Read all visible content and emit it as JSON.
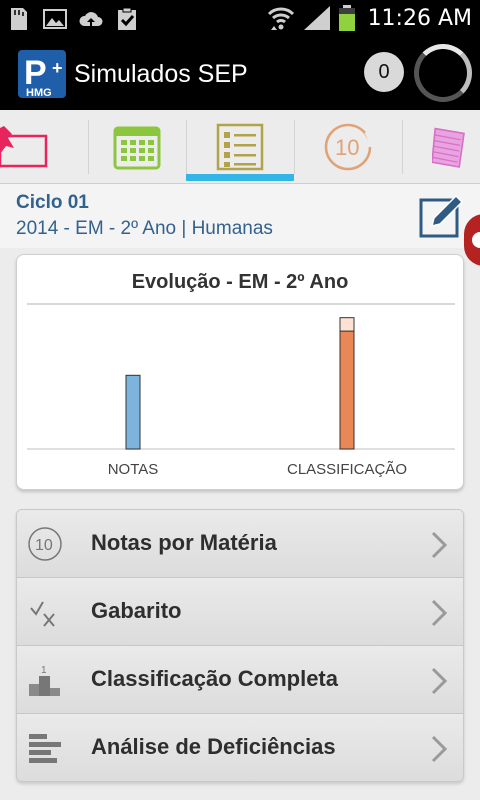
{
  "status_bar": {
    "time": "11:26 AM",
    "icons": [
      "sd-card-icon",
      "image-icon",
      "cloud-upload-icon",
      "clipboard-check-icon",
      "wifi-icon",
      "signal-icon",
      "battery-icon"
    ]
  },
  "action_bar": {
    "title": "Simulados SEP",
    "logo_text": "P",
    "logo_sub": "HMG",
    "badge_count": "0"
  },
  "tabs": [
    {
      "name": "pinned-note-tab",
      "icon": "pushpin-note-icon",
      "color": "#e8245c"
    },
    {
      "name": "calendar-tab",
      "icon": "calendar-icon",
      "color": "#8cc63f"
    },
    {
      "name": "checklist-tab",
      "icon": "checklist-icon",
      "color": "#b2a24a",
      "selected": true
    },
    {
      "name": "score-tab",
      "icon": "score-10-icon",
      "color": "#e0a276"
    },
    {
      "name": "notebook-tab",
      "icon": "notebook-icon",
      "color": "#d670c6"
    }
  ],
  "cycle": {
    "title": "Ciclo 01",
    "subtitle": "2014 - EM - 2º Ano | Humanas"
  },
  "chart_data": {
    "type": "bar",
    "title": "Evolução - EM - 2º Ano",
    "categories": [
      "NOTAS",
      "CLASSIFICAÇÃO"
    ],
    "series": [
      {
        "values": [
          0.55,
          0.88
        ]
      },
      {
        "values": [
          0,
          0.1
        ]
      }
    ],
    "colors": {
      "notas": "#7db4dd",
      "classificacao": "#e98756",
      "classificacao_top": "#fde2d4"
    },
    "ylim": [
      0,
      1
    ],
    "grid": false
  },
  "menu": {
    "items": [
      {
        "label": "Notas por Matéria",
        "icon": "score-10-icon"
      },
      {
        "label": "Gabarito",
        "icon": "check-x-icon"
      },
      {
        "label": "Classificação Completa",
        "icon": "podium-icon"
      },
      {
        "label": "Análise de Deficiências",
        "icon": "bar-list-icon"
      }
    ]
  }
}
